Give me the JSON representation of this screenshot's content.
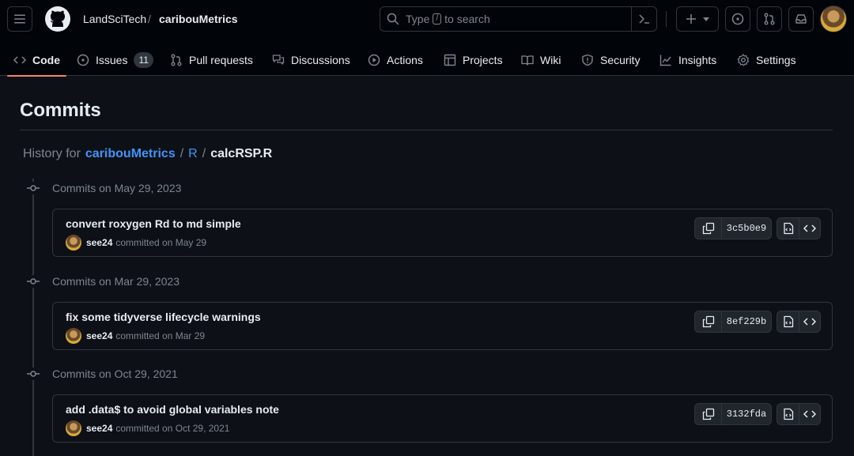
{
  "header": {
    "owner": "LandSciTech",
    "separator": "/",
    "repo": "caribouMetrics",
    "search_prefix": "Type",
    "search_key": "/",
    "search_suffix": "to search"
  },
  "tabs": [
    {
      "label": "Code",
      "icon": "code-icon",
      "active": true
    },
    {
      "label": "Issues",
      "icon": "issue-icon",
      "count": "11"
    },
    {
      "label": "Pull requests",
      "icon": "pull-request-icon"
    },
    {
      "label": "Discussions",
      "icon": "discussions-icon"
    },
    {
      "label": "Actions",
      "icon": "play-icon"
    },
    {
      "label": "Projects",
      "icon": "table-icon"
    },
    {
      "label": "Wiki",
      "icon": "book-icon"
    },
    {
      "label": "Security",
      "icon": "shield-icon"
    },
    {
      "label": "Insights",
      "icon": "graph-icon"
    },
    {
      "label": "Settings",
      "icon": "gear-icon"
    }
  ],
  "main": {
    "title": "Commits",
    "history_prefix": "History for",
    "path": [
      "caribouMetrics",
      "R",
      "calcRSP.R"
    ],
    "path_sep": "/"
  },
  "commit_groups": [
    {
      "heading": "Commits on May 29, 2023",
      "commits": [
        {
          "message": "convert roxygen Rd to md simple",
          "author": "see24",
          "when": "committed on May 29",
          "sha": "3c5b0e9"
        }
      ]
    },
    {
      "heading": "Commits on Mar 29, 2023",
      "commits": [
        {
          "message": "fix some tidyverse lifecycle warnings",
          "author": "see24",
          "when": "committed on Mar 29",
          "sha": "8ef229b"
        }
      ]
    },
    {
      "heading": "Commits on Oct 29, 2021",
      "commits": [
        {
          "message": "add .data$ to avoid global variables note",
          "author": "see24",
          "when": "committed on Oct 29, 2021",
          "sha": "3132fda"
        }
      ]
    }
  ],
  "colors": {
    "background": "#0d1117",
    "header_bg": "#010409",
    "border": "#30363d",
    "link": "#4493f8",
    "muted": "#7d8590",
    "active_tab_underline": "#f78166"
  }
}
